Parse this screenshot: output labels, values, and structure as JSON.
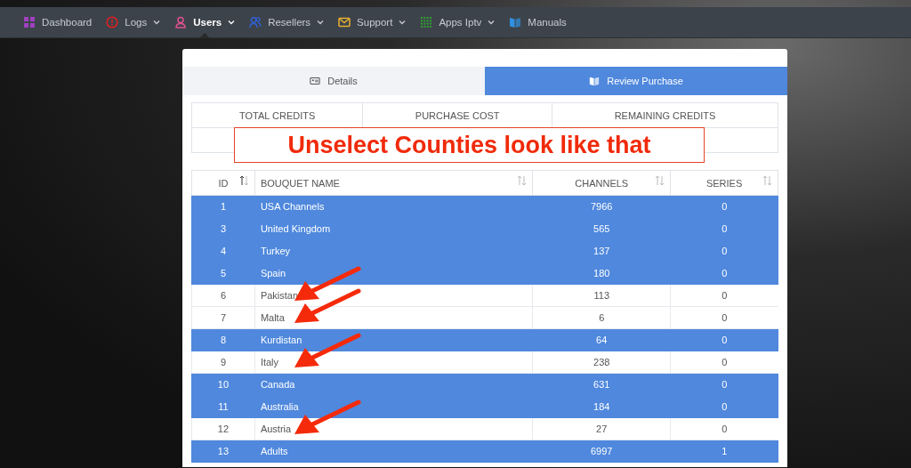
{
  "nav": [
    {
      "label": "Dashboard",
      "color": "#a040c0",
      "dropdown": false,
      "selected": false
    },
    {
      "label": "Logs",
      "color": "#e02020",
      "dropdown": true,
      "selected": false
    },
    {
      "label": "Users",
      "color": "#e05090",
      "dropdown": true,
      "selected": true
    },
    {
      "label": "Resellers",
      "color": "#3060d0",
      "dropdown": true,
      "selected": false
    },
    {
      "label": "Support",
      "color": "#e8b030",
      "dropdown": true,
      "selected": false
    },
    {
      "label": "Apps Iptv",
      "color": "#30a030",
      "dropdown": true,
      "selected": false
    },
    {
      "label": "Manuals",
      "color": "#3090e0",
      "dropdown": false,
      "selected": false
    }
  ],
  "tabs": [
    {
      "label": "Details",
      "selected": false
    },
    {
      "label": "Review Purchase",
      "selected": true
    }
  ],
  "credits_table": {
    "columns": [
      "TOTAL CREDITS",
      "PURCHASE COST",
      "REMAINING CREDITS"
    ]
  },
  "annotation": {
    "text": "Unselect Counties look like that"
  },
  "bouquets": {
    "columns": [
      {
        "label": "ID",
        "sorted": true
      },
      {
        "label": "BOUQUET NAME",
        "sorted": false
      },
      {
        "label": "CHANNELS",
        "sorted": false
      },
      {
        "label": "SERIES",
        "sorted": false
      }
    ],
    "rows": [
      {
        "id": "1",
        "name": "USA Channels",
        "channels": "7966",
        "series": "0",
        "selected": true,
        "arrow": false
      },
      {
        "id": "3",
        "name": "United Kingdom",
        "channels": "565",
        "series": "0",
        "selected": true,
        "arrow": false
      },
      {
        "id": "4",
        "name": "Turkey",
        "channels": "137",
        "series": "0",
        "selected": true,
        "arrow": false
      },
      {
        "id": "5",
        "name": "Spain",
        "channels": "180",
        "series": "0",
        "selected": true,
        "arrow": false
      },
      {
        "id": "6",
        "name": "Pakistan",
        "channels": "113",
        "series": "0",
        "selected": false,
        "arrow": true
      },
      {
        "id": "7",
        "name": "Malta",
        "channels": "6",
        "series": "0",
        "selected": false,
        "arrow": true
      },
      {
        "id": "8",
        "name": "Kurdistan",
        "channels": "64",
        "series": "0",
        "selected": true,
        "arrow": false
      },
      {
        "id": "9",
        "name": "Italy",
        "channels": "238",
        "series": "0",
        "selected": false,
        "arrow": true
      },
      {
        "id": "10",
        "name": "Canada",
        "channels": "631",
        "series": "0",
        "selected": true,
        "arrow": false
      },
      {
        "id": "11",
        "name": "Australia",
        "channels": "184",
        "series": "0",
        "selected": true,
        "arrow": false
      },
      {
        "id": "12",
        "name": "Austria",
        "channels": "27",
        "series": "0",
        "selected": false,
        "arrow": true
      },
      {
        "id": "13",
        "name": "Adults",
        "channels": "6997",
        "series": "1",
        "selected": true,
        "arrow": false
      }
    ]
  }
}
